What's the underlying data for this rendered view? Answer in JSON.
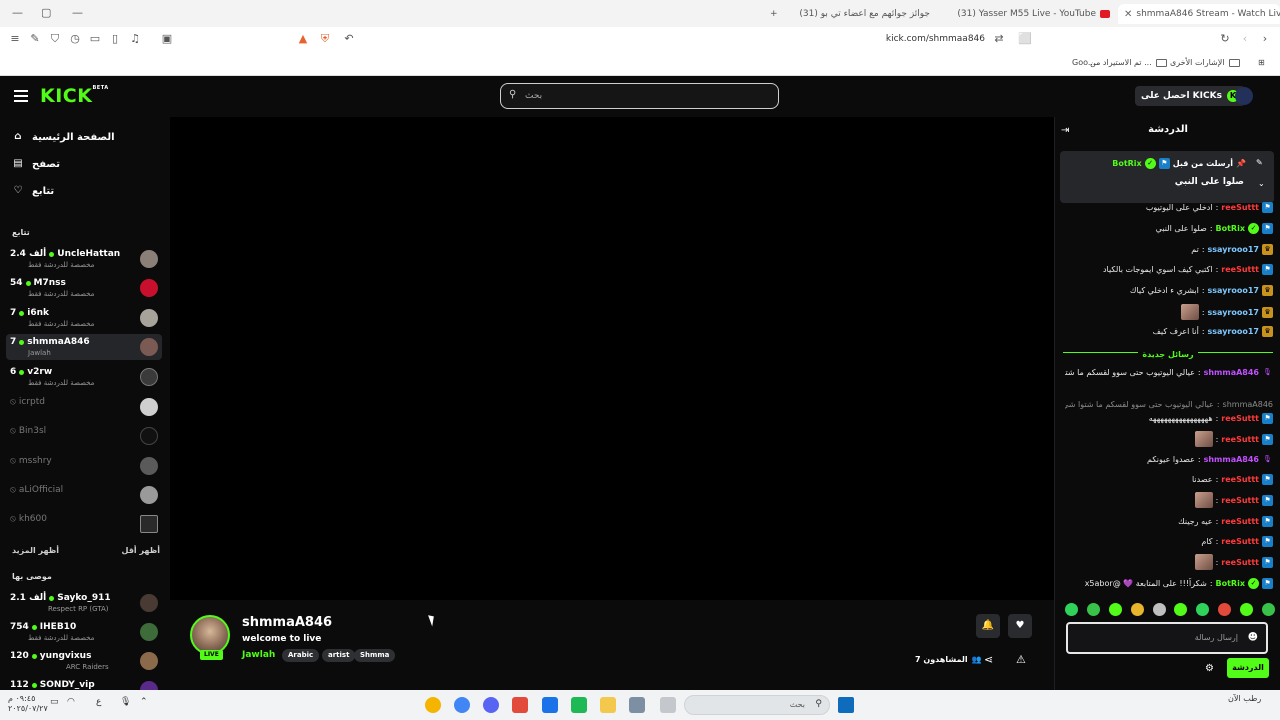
{
  "browser": {
    "tabs": [
      {
        "label": "shmmaA846 Stream - Watch Live",
        "active": true
      },
      {
        "label": "(31) Yasser M55 Live - YouTube"
      },
      {
        "label": "(31) جوائز جوائهم مع اعضاء تي بو"
      }
    ],
    "new_tab": "+",
    "url": "kick.com/shmmaa846",
    "bookmarks": [
      "الإشارات الأخرى",
      "تم الاستيراد من ...",
      "Goo..."
    ]
  },
  "header": {
    "logo": "KICK",
    "logo_beta": "BETA",
    "search_placeholder": "بحث",
    "get_kicks": "احصل على KICKs"
  },
  "sidebar": {
    "nav": [
      {
        "label": "الصفحة الرئيسية",
        "icon": "home-icon"
      },
      {
        "label": "تصفح",
        "icon": "browse-icon"
      },
      {
        "label": "تتابع",
        "icon": "heart-icon"
      }
    ],
    "following_title": "تتابع",
    "following": [
      {
        "name": "UncleHattan",
        "viewers": "2.4 ألف",
        "sub": "مخصصة للدردشة فقط",
        "live": true
      },
      {
        "name": "M7nss",
        "viewers": "54",
        "sub": "مخصصة للدردشة فقط",
        "live": true
      },
      {
        "name": "i6nk",
        "viewers": "7",
        "sub": "مخصصة للدردشة فقط",
        "live": true
      },
      {
        "name": "shmmaA846",
        "viewers": "7",
        "sub": "Jawlah",
        "live": true
      },
      {
        "name": "v2rw",
        "viewers": "6",
        "sub": "مخصصة للدردشة فقط",
        "live": true
      },
      {
        "name": "icrptd",
        "live": false
      },
      {
        "name": "Bin3sl",
        "live": false
      },
      {
        "name": "msshry",
        "live": false
      },
      {
        "name": "aLiOfficial",
        "live": false
      },
      {
        "name": "kh600",
        "live": false
      }
    ],
    "show_more": "أظهر المزيد",
    "show_less": "أظهر أقل",
    "recommended_title": "موصى بها",
    "recommended": [
      {
        "name": "Sayko_911",
        "viewers": "2.1 ألف",
        "sub": "Respect RP (GTA)"
      },
      {
        "name": "IHEB10",
        "viewers": "754",
        "sub": "مخصصة للدردشة فقط"
      },
      {
        "name": "yungvixus",
        "viewers": "120",
        "sub": "ARC Raiders"
      },
      {
        "name": "SONDY_vip",
        "viewers": "112",
        "sub": ""
      }
    ]
  },
  "stream": {
    "streamer": "shmmaA846",
    "title": "welcome to live",
    "category": "Jawlah",
    "tags": [
      "Arabic",
      "artist",
      "Shmma"
    ],
    "live_label": "LIVE",
    "viewers_label": "المشاهدون 7"
  },
  "chat": {
    "title": "الدردشة",
    "pinned": {
      "by": "أرسلت من قبل",
      "user": "BotRix",
      "message": "صلوا على النبي"
    },
    "messages_before": [
      {
        "user": "reeSuttt",
        "badge": "blue",
        "color": "#ff3b3b",
        "text": "ادخلي على اليوتيوب"
      },
      {
        "user": "BotRix",
        "badge": "blue",
        "verified": true,
        "color": "#53fc18",
        "text": "صلوا على النبي"
      },
      {
        "user": "ssayrooo17",
        "badge": "gold",
        "color": "#7ec8ff",
        "text": "تم"
      },
      {
        "user": "reeSuttt",
        "badge": "blue",
        "color": "#ff3b3b",
        "text": "اكتبي كيف اسوي ايموجات بالكياد"
      },
      {
        "user": "ssayrooo17",
        "badge": "gold",
        "color": "#7ec8ff",
        "text": "ابشري ء ادخلي كياك"
      },
      {
        "user": "ssayrooo17",
        "badge": "gold",
        "color": "#7ec8ff",
        "text": "",
        "emote": true
      },
      {
        "user": "ssayrooo17",
        "badge": "gold",
        "color": "#7ec8ff",
        "text": "أنا اعرف كيف"
      }
    ],
    "new_messages": "رسائل جديدة",
    "messages_after": [
      {
        "user": "shmmaA846",
        "badge": "mic",
        "color": "#c150ff",
        "text": "عيالي اليوتيوب حتى سوو لقسكم ما شتوا شي"
      },
      {
        "user": "shmmaA846",
        "badge": "",
        "color": "#8a8a8a",
        "text": "عيالي اليوتيوب حتى سوو لقسكم ما شتوا شي ..."
      },
      {
        "user": "reeSuttt",
        "badge": "blue",
        "color": "#ff3b3b",
        "text": "ههههههههههههههههه"
      },
      {
        "user": "reeSuttt",
        "badge": "blue",
        "color": "#ff3b3b",
        "text": "",
        "emote": true
      },
      {
        "user": "shmmaA846",
        "badge": "mic",
        "color": "#c150ff",
        "text": "عصدوا عيونكم"
      },
      {
        "user": "reeSuttt",
        "badge": "blue",
        "color": "#ff3b3b",
        "text": "عصدنا"
      },
      {
        "user": "reeSuttt",
        "badge": "blue",
        "color": "#ff3b3b",
        "text": "",
        "emote": true
      },
      {
        "user": "reeSuttt",
        "badge": "blue",
        "color": "#ff3b3b",
        "text": "عيه رجينك"
      },
      {
        "user": "reeSuttt",
        "badge": "blue",
        "color": "#ff3b3b",
        "text": "كام"
      },
      {
        "user": "reeSuttt",
        "badge": "blue",
        "color": "#ff3b3b",
        "text": "",
        "emote": true
      },
      {
        "user": "BotRix",
        "badge": "blue",
        "verified": true,
        "color": "#53fc18",
        "text": "شكراً!!! على المتابعة 💜 @x5abor"
      }
    ],
    "input_placeholder": "إرسال رسالة",
    "send_label": "الدردشة"
  },
  "taskbar": {
    "search_placeholder": "بحث",
    "time": "٠٩:٤٥ م",
    "date": "٢٠٢٥/٠٧/٢٧",
    "lang": "ع",
    "weather": "رطب الآن"
  },
  "colors": {
    "kick_green": "#53fc18",
    "bg": "#0b0b0c"
  }
}
